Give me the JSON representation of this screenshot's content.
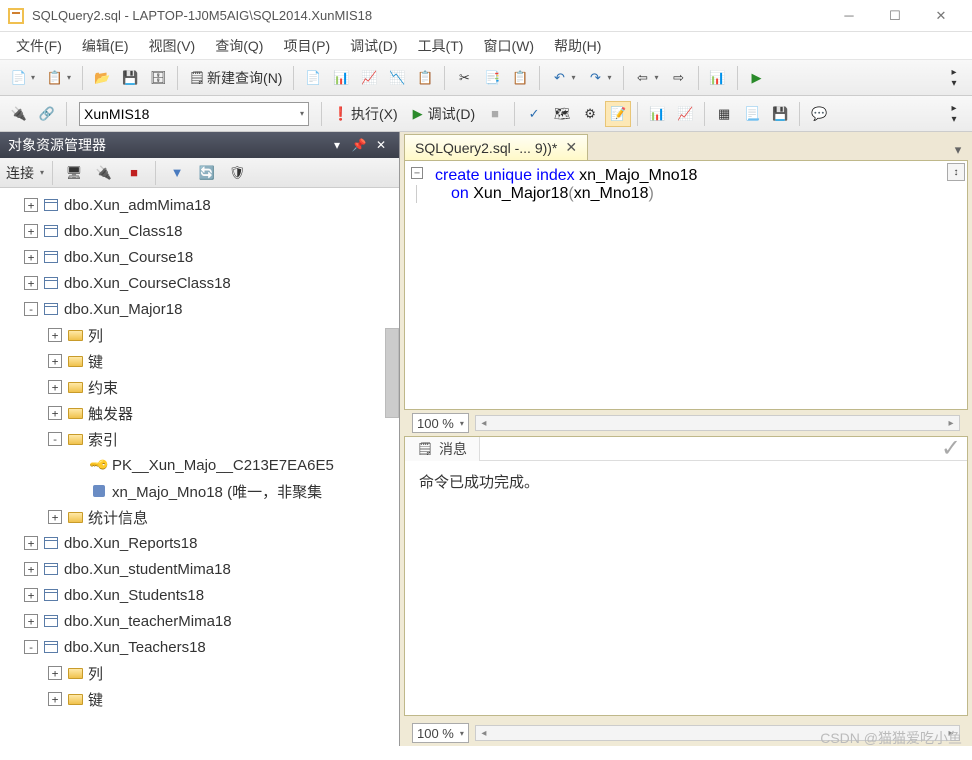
{
  "window": {
    "title": "SQLQuery2.sql - LAPTOP-1J0M5AIG\\SQL2014.XunMIS18"
  },
  "menu": [
    "文件(F)",
    "编辑(E)",
    "视图(V)",
    "查询(Q)",
    "项目(P)",
    "调试(D)",
    "工具(T)",
    "窗口(W)",
    "帮助(H)"
  ],
  "toolbar1": {
    "new_query": "新建查询(N)"
  },
  "toolbar2": {
    "db_selected": "XunMIS18",
    "execute": "执行(X)",
    "debug": "调试(D)"
  },
  "explorer": {
    "title": "对象资源管理器",
    "connect_label": "连接",
    "nodes": [
      {
        "level": 1,
        "exp": "+",
        "icon": "table",
        "label": "dbo.Xun_admMima18"
      },
      {
        "level": 1,
        "exp": "+",
        "icon": "table",
        "label": "dbo.Xun_Class18"
      },
      {
        "level": 1,
        "exp": "+",
        "icon": "table",
        "label": "dbo.Xun_Course18"
      },
      {
        "level": 1,
        "exp": "+",
        "icon": "table",
        "label": "dbo.Xun_CourseClass18"
      },
      {
        "level": 1,
        "exp": "-",
        "icon": "table",
        "label": "dbo.Xun_Major18"
      },
      {
        "level": 2,
        "exp": "+",
        "icon": "folder",
        "label": "列"
      },
      {
        "level": 2,
        "exp": "+",
        "icon": "folder",
        "label": "键"
      },
      {
        "level": 2,
        "exp": "+",
        "icon": "folder",
        "label": "约束"
      },
      {
        "level": 2,
        "exp": "+",
        "icon": "folder",
        "label": "触发器"
      },
      {
        "level": 2,
        "exp": "-",
        "icon": "folder",
        "label": "索引"
      },
      {
        "level": 3,
        "exp": " ",
        "icon": "key",
        "label": "PK__Xun_Majo__C213E7EA6E5"
      },
      {
        "level": 3,
        "exp": " ",
        "icon": "index",
        "label": "xn_Majo_Mno18 (唯一，非聚集"
      },
      {
        "level": 2,
        "exp": "+",
        "icon": "folder",
        "label": "统计信息"
      },
      {
        "level": 1,
        "exp": "+",
        "icon": "table",
        "label": "dbo.Xun_Reports18"
      },
      {
        "level": 1,
        "exp": "+",
        "icon": "table",
        "label": "dbo.Xun_studentMima18"
      },
      {
        "level": 1,
        "exp": "+",
        "icon": "table",
        "label": "dbo.Xun_Students18"
      },
      {
        "level": 1,
        "exp": "+",
        "icon": "table",
        "label": "dbo.Xun_teacherMima18"
      },
      {
        "level": 1,
        "exp": "-",
        "icon": "table",
        "label": "dbo.Xun_Teachers18"
      },
      {
        "level": 2,
        "exp": "+",
        "icon": "folder",
        "label": "列"
      },
      {
        "level": 2,
        "exp": "+",
        "icon": "folder",
        "label": "键"
      }
    ]
  },
  "editor": {
    "tab_label": "SQLQuery2.sql -...                         9))*",
    "code": {
      "kw_create": "create",
      "kw_unique": "unique",
      "kw_index": "index",
      "idx_name": "xn_Majo_Mno18",
      "kw_on": "on",
      "table_name": "Xun_Major18",
      "col_name": "xn_Mno18"
    },
    "zoom": "100 %"
  },
  "messages": {
    "tab": "消息",
    "text": "命令已成功完成。"
  },
  "watermark": "CSDN @猫猫爱吃小鱼"
}
